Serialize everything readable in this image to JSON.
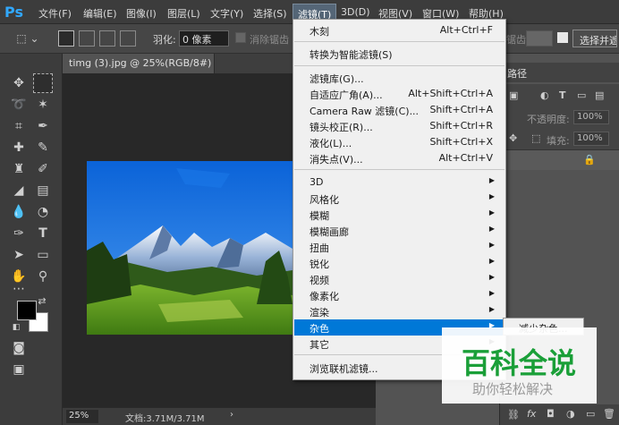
{
  "app": {
    "logo": "Ps"
  },
  "menubar": {
    "items": [
      "文件(F)",
      "编辑(E)",
      "图像(I)",
      "图层(L)",
      "文字(Y)",
      "选择(S)",
      "滤镜(T)",
      "3D(D)",
      "视图(V)",
      "窗口(W)",
      "帮助(H)"
    ],
    "active": "滤镜(T)"
  },
  "options": {
    "feather_label": "羽化:",
    "feather_value": "0 像素",
    "antialias_label": "消除锯齿",
    "select_mask_label": "选择并遮",
    "behind_label": "锯齿"
  },
  "document": {
    "tab_title": "timg (3).jpg @ 25%(RGB/8#) *",
    "close": "×",
    "zoom": "25%",
    "doc_size": "文档:3.71M/3.71M",
    "status_arrow": "›"
  },
  "filter_menu": {
    "top": [
      {
        "label": "木刻",
        "shortcut": "Alt+Ctrl+F"
      }
    ],
    "smart": [
      {
        "label": "转换为智能滤镜(S)",
        "shortcut": ""
      }
    ],
    "group1": [
      {
        "label": "滤镜库(G)...",
        "shortcut": ""
      },
      {
        "label": "自适应广角(A)...",
        "shortcut": "Alt+Shift+Ctrl+A"
      },
      {
        "label": "Camera Raw 滤镜(C)...",
        "shortcut": "Shift+Ctrl+A"
      },
      {
        "label": "镜头校正(R)...",
        "shortcut": "Shift+Ctrl+R"
      },
      {
        "label": "液化(L)...",
        "shortcut": "Shift+Ctrl+X"
      },
      {
        "label": "消失点(V)...",
        "shortcut": "Alt+Ctrl+V"
      }
    ],
    "group2": [
      {
        "label": "3D",
        "submenu": true
      },
      {
        "label": "风格化",
        "submenu": true
      },
      {
        "label": "模糊",
        "submenu": true
      },
      {
        "label": "模糊画廊",
        "submenu": true
      },
      {
        "label": "扭曲",
        "submenu": true
      },
      {
        "label": "锐化",
        "submenu": true
      },
      {
        "label": "视频",
        "submenu": true
      },
      {
        "label": "像素化",
        "submenu": true
      },
      {
        "label": "渲染",
        "submenu": true
      },
      {
        "label": "杂色",
        "submenu": true,
        "highlighted": true
      },
      {
        "label": "其它",
        "submenu": true
      }
    ],
    "browse": [
      {
        "label": "浏览联机滤镜...",
        "shortcut": ""
      }
    ],
    "submenu_arrow": "▶",
    "noise_submenu_first": "减少杂色..."
  },
  "right_panel": {
    "tab_label": "路径",
    "opacity_label": "不透明度:",
    "opacity_value": "100%",
    "fill_label": "填充:",
    "fill_value": "100%",
    "lock_icon": "lock-icon"
  },
  "watermark": {
    "main": "百科全说",
    "sub": "助你轻松解决"
  },
  "colors": {
    "foreground": "#000000",
    "background": "#ffffff",
    "menu_highlight": "#0078d7",
    "watermark_green": "#1a9f38"
  }
}
